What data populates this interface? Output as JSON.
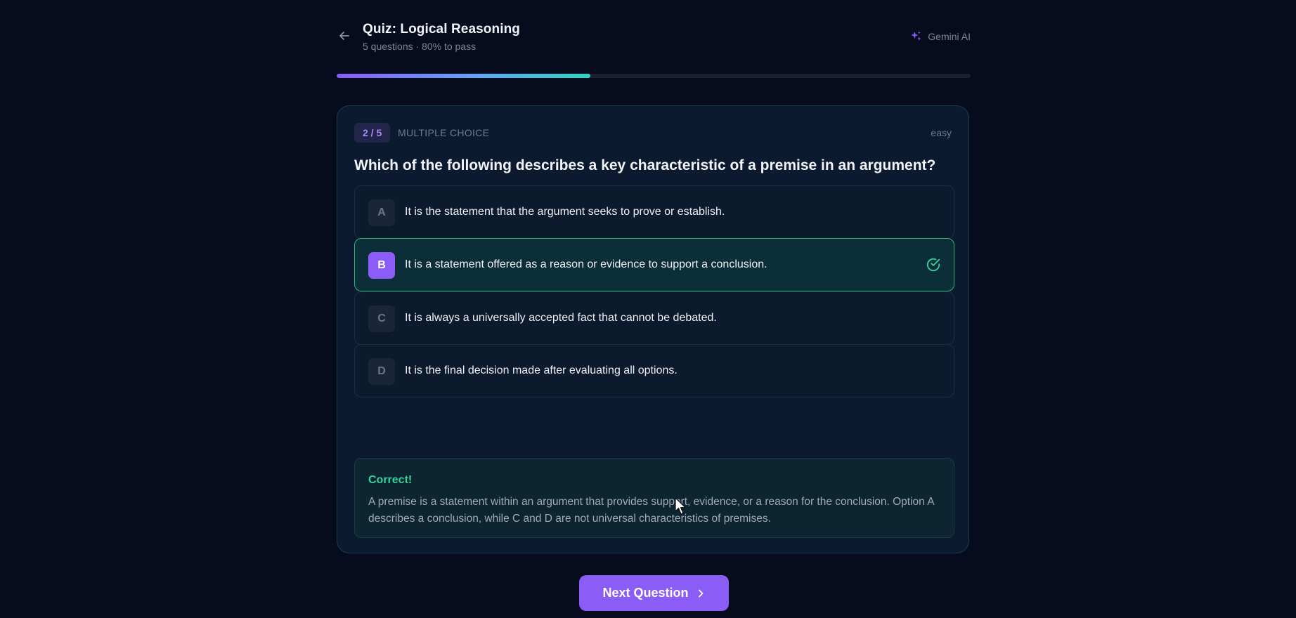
{
  "header": {
    "title": "Quiz: Logical Reasoning",
    "subtitle": "5 questions · 80% to pass",
    "ai_label": "Gemini AI",
    "back_icon": "arrow-left-icon",
    "ai_icon": "sparkles-icon"
  },
  "progress": {
    "fraction": 0.4
  },
  "question": {
    "counter": "2 / 5",
    "type": "MULTIPLE CHOICE",
    "difficulty": "easy",
    "text": "Which of the following describes a key characteristic of a premise in an argument?"
  },
  "options": [
    {
      "letter": "A",
      "text": "It is the statement that the argument seeks to prove or establish.",
      "state": "default"
    },
    {
      "letter": "B",
      "text": "It is a statement offered as a reason or evidence to support a conclusion.",
      "state": "correct"
    },
    {
      "letter": "C",
      "text": "It is always a universally accepted fact that cannot be debated.",
      "state": "default"
    },
    {
      "letter": "D",
      "text": "It is the final decision made after evaluating all options.",
      "state": "default"
    }
  ],
  "feedback": {
    "title": "Correct!",
    "text": "A premise is a statement within an argument that provides support, evidence, or a reason for the conclusion. Option A describes a conclusion, while C and D are not universal characteristics of premises."
  },
  "next_button": {
    "label": "Next Question",
    "icon": "chevron-right-icon"
  },
  "colors": {
    "accent": "#8b5cf6",
    "correct": "#34d399",
    "background": "#070b1e"
  }
}
